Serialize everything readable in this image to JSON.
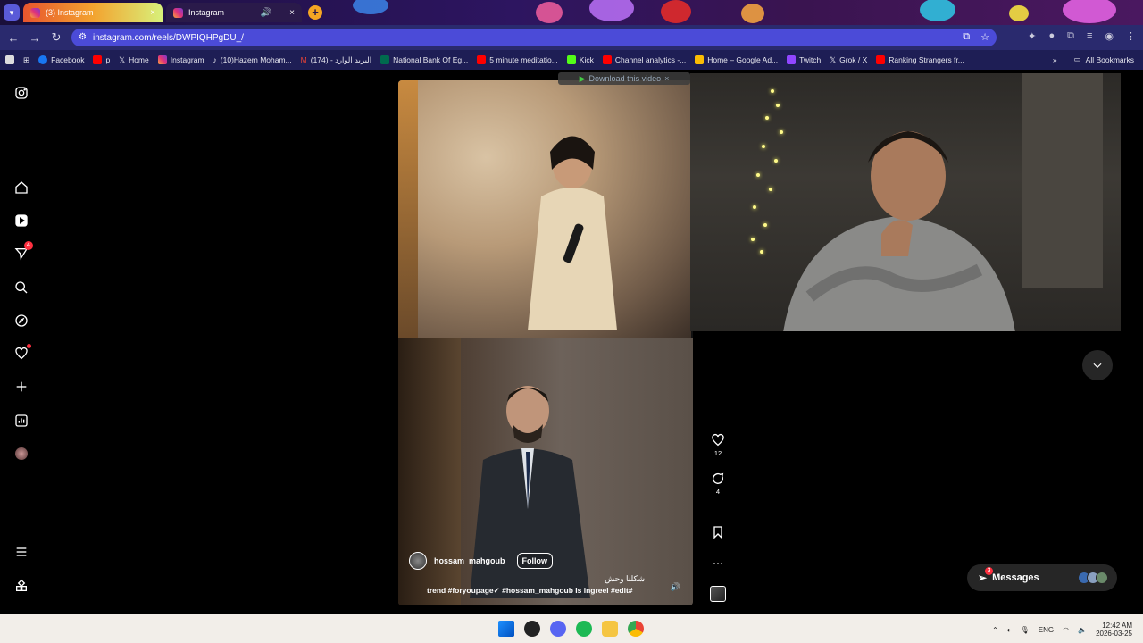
{
  "browser": {
    "tabs": [
      {
        "title": "(3) Instagram",
        "active": true
      },
      {
        "title": "Instagram",
        "active": false
      }
    ],
    "url": "instagram.com/reels/DWPIQHPgDU_/",
    "bookmarks": [
      {
        "label": "Facebook",
        "color": "#1877f2"
      },
      {
        "label": "p",
        "color": "#ff0000"
      },
      {
        "label": "Home",
        "color": "#000000"
      },
      {
        "label": "Instagram",
        "color": "#e0337a"
      },
      {
        "label": "(10)Hazem Moham...",
        "color": "#111111"
      },
      {
        "label": "(174) - البريد الوارد",
        "color": "#ea4335"
      },
      {
        "label": "National Bank Of Eg...",
        "color": "#006a4e"
      },
      {
        "label": "5 minute meditatio...",
        "color": "#ff0000"
      },
      {
        "label": "Kick",
        "color": "#53fc18"
      },
      {
        "label": "Channel analytics -...",
        "color": "#ff0000"
      },
      {
        "label": "Home – Google Ad...",
        "color": "#fbbc04"
      },
      {
        "label": "Twitch",
        "color": "#9146ff"
      },
      {
        "label": "Grok / X",
        "color": "#000000"
      },
      {
        "label": "Ranking Strangers fr...",
        "color": "#ff0000"
      }
    ],
    "all_bookmarks": "All Bookmarks"
  },
  "sidenav": {
    "items": [
      {
        "name": "instagram-logo-icon"
      },
      {
        "name": "home-icon"
      },
      {
        "name": "reels-icon"
      },
      {
        "name": "messages-nav-icon",
        "badge": "4"
      },
      {
        "name": "search-icon"
      },
      {
        "name": "explore-icon"
      },
      {
        "name": "notifications-icon"
      },
      {
        "name": "create-icon"
      },
      {
        "name": "dashboard-icon"
      },
      {
        "name": "profile-avatar"
      },
      {
        "name": "more-menu-icon"
      },
      {
        "name": "also-from-meta-icon"
      }
    ]
  },
  "reel": {
    "download_label": "Download this video",
    "author": "hossam_mahgoub_",
    "follow_label": "Follow",
    "caption_ar": "شكلنا وحش",
    "caption_tags": "trend #foryoupage✓ #hossam_mahgoub Is ingreel #edit#",
    "likes": "12",
    "comments": "4"
  },
  "messages": {
    "label": "Messages",
    "badge": "3"
  },
  "taskbar": {
    "lang": "ENG",
    "time": "12:42 AM",
    "date": "2026-03-25"
  },
  "colors": {
    "ig_badge": "#ff3040",
    "omnibox": "#4b4bd8",
    "toolbar": "#2a2a6e"
  }
}
